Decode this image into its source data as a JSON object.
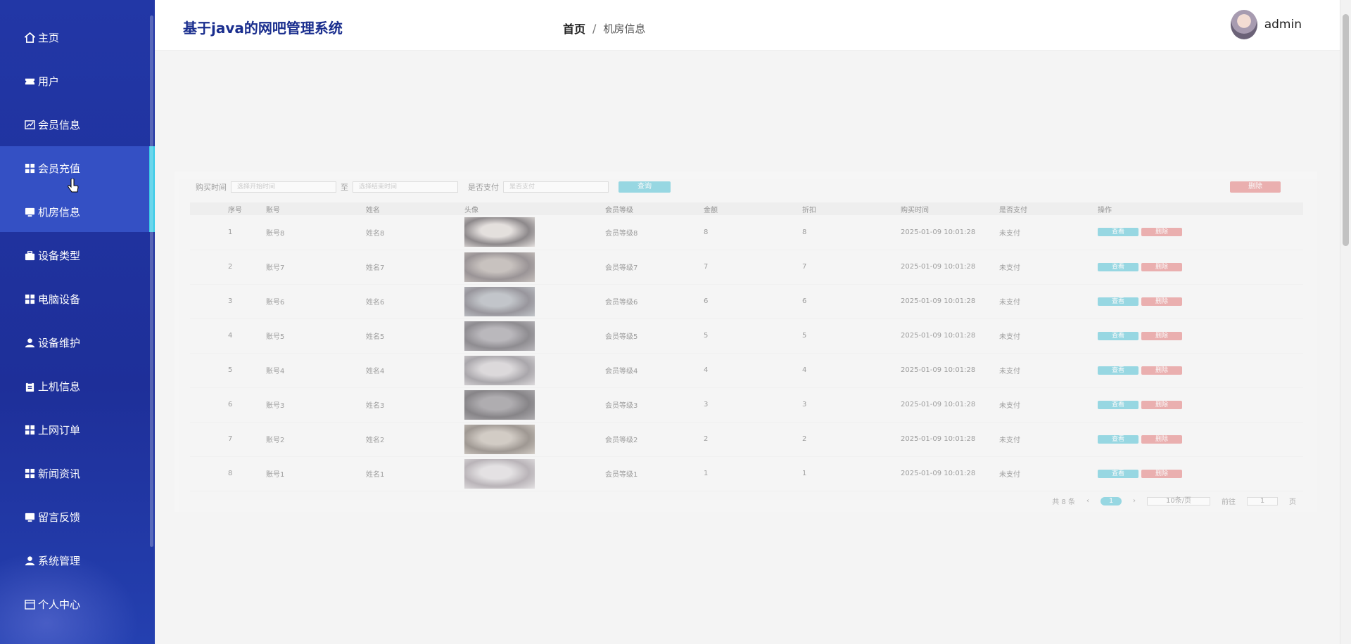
{
  "app": {
    "title": "基于java的网吧管理系统"
  },
  "breadcrumb": {
    "home": "首页",
    "separator": "/",
    "current": "机房信息"
  },
  "user": {
    "name": "admin"
  },
  "sidebar": {
    "items": [
      {
        "label": "主页",
        "icon": "home-icon"
      },
      {
        "label": "用户",
        "icon": "ticket-icon"
      },
      {
        "label": "会员信息",
        "icon": "chart-icon"
      },
      {
        "label": "会员充值",
        "icon": "grid-icon"
      },
      {
        "label": "机房信息",
        "icon": "monitor-icon"
      },
      {
        "label": "设备类型",
        "icon": "briefcase-icon"
      },
      {
        "label": "电脑设备",
        "icon": "grid-icon"
      },
      {
        "label": "设备维护",
        "icon": "user-icon"
      },
      {
        "label": "上机信息",
        "icon": "clipboard-icon"
      },
      {
        "label": "上网订单",
        "icon": "grid-icon"
      },
      {
        "label": "新闻资讯",
        "icon": "grid-icon"
      },
      {
        "label": "留言反馈",
        "icon": "monitor-icon"
      },
      {
        "label": "系统管理",
        "icon": "user-icon"
      },
      {
        "label": "个人中心",
        "icon": "calendar-icon"
      }
    ]
  },
  "filters": {
    "label_time": "购买时间",
    "placeholder_start": "选择开始时间",
    "label_to": "至",
    "placeholder_end": "选择结束时间",
    "label_paid": "是否支付",
    "placeholder_paid": "是否支付",
    "search": "查询",
    "delete": "删除"
  },
  "table": {
    "headers": [
      "",
      "序号",
      "账号",
      "姓名",
      "头像",
      "会员等级",
      "金额",
      "折扣",
      "购买时间",
      "是否支付",
      "操作"
    ],
    "rows": [
      {
        "no": "1",
        "account": "账号8",
        "name": "姓名8",
        "level": "会员等级8",
        "amount": "8",
        "discount": "8",
        "time": "2025-01-09 10:01:28",
        "paid": "未支付"
      },
      {
        "no": "2",
        "account": "账号7",
        "name": "姓名7",
        "level": "会员等级7",
        "amount": "7",
        "discount": "7",
        "time": "2025-01-09 10:01:28",
        "paid": "未支付"
      },
      {
        "no": "3",
        "account": "账号6",
        "name": "姓名6",
        "level": "会员等级6",
        "amount": "6",
        "discount": "6",
        "time": "2025-01-09 10:01:28",
        "paid": "未支付"
      },
      {
        "no": "4",
        "account": "账号5",
        "name": "姓名5",
        "level": "会员等级5",
        "amount": "5",
        "discount": "5",
        "time": "2025-01-09 10:01:28",
        "paid": "未支付"
      },
      {
        "no": "5",
        "account": "账号4",
        "name": "姓名4",
        "level": "会员等级4",
        "amount": "4",
        "discount": "4",
        "time": "2025-01-09 10:01:28",
        "paid": "未支付"
      },
      {
        "no": "6",
        "account": "账号3",
        "name": "姓名3",
        "level": "会员等级3",
        "amount": "3",
        "discount": "3",
        "time": "2025-01-09 10:01:28",
        "paid": "未支付"
      },
      {
        "no": "7",
        "account": "账号2",
        "name": "姓名2",
        "level": "会员等级2",
        "amount": "2",
        "discount": "2",
        "time": "2025-01-09 10:01:28",
        "paid": "未支付"
      },
      {
        "no": "8",
        "account": "账号1",
        "name": "姓名1",
        "level": "会员等级1",
        "amount": "1",
        "discount": "1",
        "time": "2025-01-09 10:01:28",
        "paid": "未支付"
      }
    ],
    "ops": {
      "view": "查看",
      "delete": "删除"
    }
  },
  "pager": {
    "total": "共 8 条",
    "page": "1",
    "size": "10条/页",
    "goto": "前往",
    "goto_value": "1",
    "unit": "页"
  },
  "colors": {
    "sidebar": "#1e2f99",
    "active": "#3450c4",
    "accent": "#39c9e6",
    "danger": "#e27777"
  }
}
